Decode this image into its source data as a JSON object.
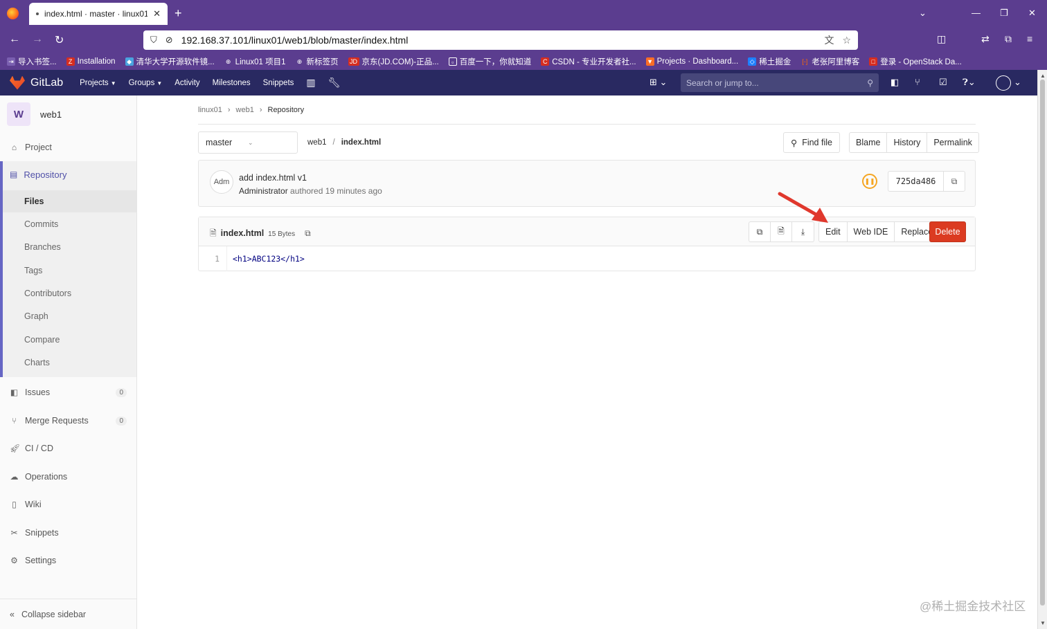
{
  "browser": {
    "tab_title": "index.html · master · linux01 /",
    "url": "192.168.37.101/linux01/web1/blob/master/index.html",
    "bookmarks": [
      {
        "label": "导入书签...",
        "color": "#5b3d8f"
      },
      {
        "label": "Installation",
        "color": "#d62d20",
        "glyph": "Z"
      },
      {
        "label": "清华大学开源软件镜...",
        "color": "#4aa3df"
      },
      {
        "label": "Linux01 项目1",
        "color": "#5b3d8f"
      },
      {
        "label": "新标签页",
        "color": "#5b3d8f"
      },
      {
        "label": "京东(JD.COM)-正品...",
        "color": "#d62d20",
        "glyph": "JD"
      },
      {
        "label": "百度一下，你就知道",
        "color": "#2932e1"
      },
      {
        "label": "CSDN - 专业开发者社...",
        "color": "#d62d20",
        "glyph": "C"
      },
      {
        "label": "Projects · Dashboard...",
        "color": "#fc6d26"
      },
      {
        "label": "稀土掘金",
        "color": "#1e80ff"
      },
      {
        "label": "老张阿里博客",
        "color": "#ff6a00"
      },
      {
        "label": "登录 - OpenStack Da...",
        "color": "#d62d20"
      }
    ]
  },
  "gitlab": {
    "brand": "GitLab",
    "nav": [
      {
        "label": "Projects",
        "caret": true
      },
      {
        "label": "Groups",
        "caret": true
      },
      {
        "label": "Activity",
        "caret": false
      },
      {
        "label": "Milestones",
        "caret": false
      },
      {
        "label": "Snippets",
        "caret": false
      }
    ],
    "search_placeholder": "Search or jump to..."
  },
  "sidebar": {
    "project_initial": "W",
    "project_name": "web1",
    "project_label": "Project",
    "repository_label": "Repository",
    "repo_subitems": [
      "Files",
      "Commits",
      "Branches",
      "Tags",
      "Contributors",
      "Graph",
      "Compare",
      "Charts"
    ],
    "issues_label": "Issues",
    "issues_count": "0",
    "mr_label": "Merge Requests",
    "mr_count": "0",
    "cicd_label": "CI / CD",
    "operations_label": "Operations",
    "wiki_label": "Wiki",
    "snippets_label": "Snippets",
    "settings_label": "Settings",
    "collapse_label": "Collapse sidebar"
  },
  "breadcrumb": {
    "group": "linux01",
    "project": "web1",
    "current": "Repository"
  },
  "file_nav": {
    "branch": "master",
    "path_root": "web1",
    "path_sep": "/",
    "path_file": "index.html",
    "find_file": "Find file",
    "blame": "Blame",
    "history": "History",
    "permalink": "Permalink"
  },
  "commit": {
    "avatar_text": "Adm",
    "message": "add index.html v1",
    "author": "Administrator",
    "authored_text": "authored 19 minutes ago",
    "sha": "725da486"
  },
  "file": {
    "name": "index.html",
    "size": "15 Bytes",
    "edit": "Edit",
    "web_ide": "Web IDE",
    "replace": "Replace",
    "delete": "Delete",
    "line_number": "1",
    "code_line": "<h1>ABC123</h1>"
  },
  "watermark": "@稀土掘金技术社区",
  "colors": {
    "browser_purple": "#5b3d8f",
    "gitlab_header": "#292961",
    "accent": "#6666c4",
    "delete_red": "#db3b21",
    "arrow_red": "#e0382d"
  }
}
